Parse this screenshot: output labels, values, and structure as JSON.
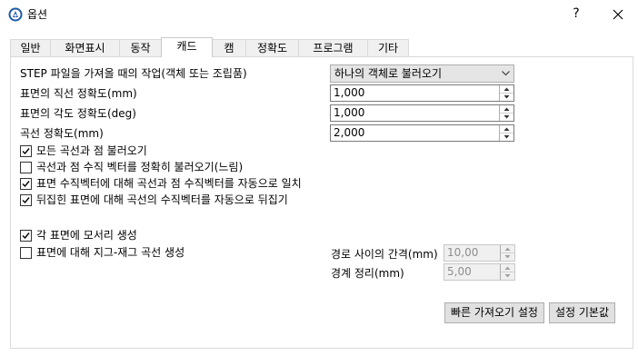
{
  "window": {
    "title": "옵션",
    "help_label": "?"
  },
  "tabs": [
    {
      "label": "일반"
    },
    {
      "label": "화면표시"
    },
    {
      "label": "동작"
    },
    {
      "label": "캐드"
    },
    {
      "label": "캠"
    },
    {
      "label": "정확도"
    },
    {
      "label": "프로그램"
    },
    {
      "label": "기타"
    }
  ],
  "active_tab": "캐드",
  "cad": {
    "step_import_label": "STEP 파일을 가져올 때의 작업(객체 또는 조립품)",
    "step_import_value": "하나의 객체로 불러오기",
    "surface_linear_label": "표면의 직선 정확도(mm)",
    "surface_linear_value": "1,000",
    "surface_angle_label": "표면의 각도 정확도(deg)",
    "surface_angle_value": "1,000",
    "curve_accuracy_label": "곡선 정확도(mm)",
    "curve_accuracy_value": "2,000",
    "checkboxes": [
      {
        "label": "모든 곡선과 점 불러오기",
        "checked": true
      },
      {
        "label": "곡선과 점 수직 벡터를 정확히 불러오기(느림)",
        "checked": false
      },
      {
        "label": "표면 수직벡터에 대해 곡선과 점 수직벡터를 자동으로 일치",
        "checked": true
      },
      {
        "label": "뒤집힌 표면에 대해 곡선의 수직벡터를 자동으로 뒤집기",
        "checked": true
      }
    ],
    "corner_curves": {
      "label": "각 표면에 모서리 생성",
      "checked": true
    },
    "zigzag": {
      "label": "표면에 대해 지그-재그 곡선 생성",
      "checked": false
    },
    "path_spacing_label": "경로 사이의 간격(mm)",
    "path_spacing_value": "10,00",
    "boundary_label": "경계 정리(mm)",
    "boundary_value": "5,00"
  },
  "buttons": {
    "quick_import": "빠른 가져오기 설정",
    "defaults": "설정 기본값"
  },
  "colors": {
    "app_icon": "#1e5aa8",
    "check": "#000000"
  }
}
